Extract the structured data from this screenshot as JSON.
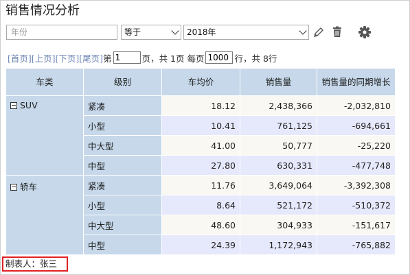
{
  "title": "销售情况分析",
  "filter": {
    "field_placeholder": "年份",
    "operator": "等于",
    "value": "2018年"
  },
  "icons": {
    "edit": "pencil-icon",
    "delete": "trash-icon",
    "settings": "gear-icon"
  },
  "pager": {
    "first": "[首页]",
    "prev": "[上页]",
    "next": "[下页]",
    "last": "[尾页]",
    "goto_prefix": "第",
    "page_value": "1",
    "total_text": "页，共 1页 每页",
    "per_page_value": "1000",
    "rows_text": "行，共 8行"
  },
  "table": {
    "headers": [
      "车类",
      "级别",
      "车均价",
      "销售量",
      "销售量的同期增长"
    ],
    "groups": [
      {
        "category": "SUV",
        "rows": [
          {
            "level": "紧凑",
            "avg_price": "18.12",
            "sales": "2,438,366",
            "yoy": "-2,032,810"
          },
          {
            "level": "小型",
            "avg_price": "10.41",
            "sales": "761,125",
            "yoy": "-694,661"
          },
          {
            "level": "中大型",
            "avg_price": "41.00",
            "sales": "50,777",
            "yoy": "-25,220"
          },
          {
            "level": "中型",
            "avg_price": "27.80",
            "sales": "630,331",
            "yoy": "-477,748"
          }
        ]
      },
      {
        "category": "轿车",
        "rows": [
          {
            "level": "紧凑",
            "avg_price": "11.76",
            "sales": "3,649,064",
            "yoy": "-3,392,308"
          },
          {
            "level": "小型",
            "avg_price": "8.64",
            "sales": "521,172",
            "yoy": "-510,372"
          },
          {
            "level": "中大型",
            "avg_price": "48.60",
            "sales": "304,933",
            "yoy": "-151,617"
          },
          {
            "level": "中型",
            "avg_price": "24.39",
            "sales": "1,172,943",
            "yoy": "-765,882"
          }
        ]
      }
    ]
  },
  "footer": "制表人：张三",
  "colors": {
    "header_bg": "#c6d8ea",
    "row_odd_bg": "#f9f8f2",
    "row_even_bg": "#e6e8fb",
    "footer_border": "#e02020",
    "pager_link": "#6b84b3"
  }
}
